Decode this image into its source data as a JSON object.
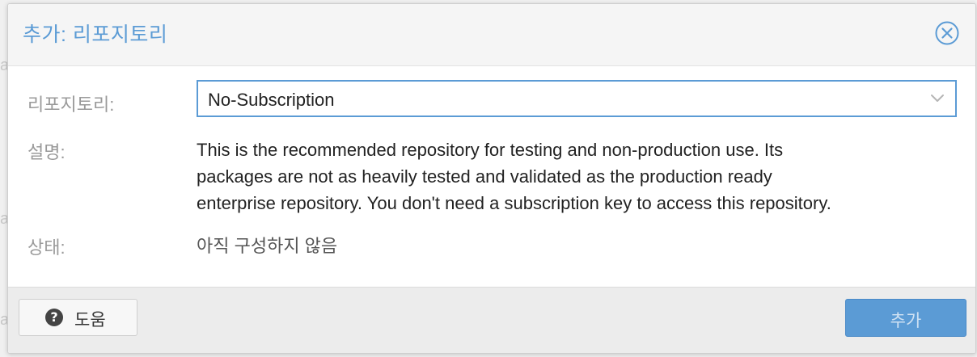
{
  "dialog": {
    "title": "추가: 리포지토리"
  },
  "form": {
    "repository_label": "리포지토리:",
    "repository_value": "No-Subscription",
    "description_label": "설명:",
    "description_lines": [
      "This is the recommended repository for testing and non-production use. Its",
      "packages are not as heavily tested and validated as the production ready",
      "enterprise repository. You don't need a subscription key to access this repository."
    ],
    "status_label": "상태:",
    "status_value": "아직 구성하지 않음"
  },
  "footer": {
    "help_label": "도움",
    "add_label": "추가"
  },
  "icons": {
    "close": "close-circle-icon",
    "help": "question-circle-icon",
    "dropdown": "chevron-down-icon"
  },
  "colors": {
    "accent": "#5b9bd5",
    "label_gray": "#9a9a9a"
  }
}
